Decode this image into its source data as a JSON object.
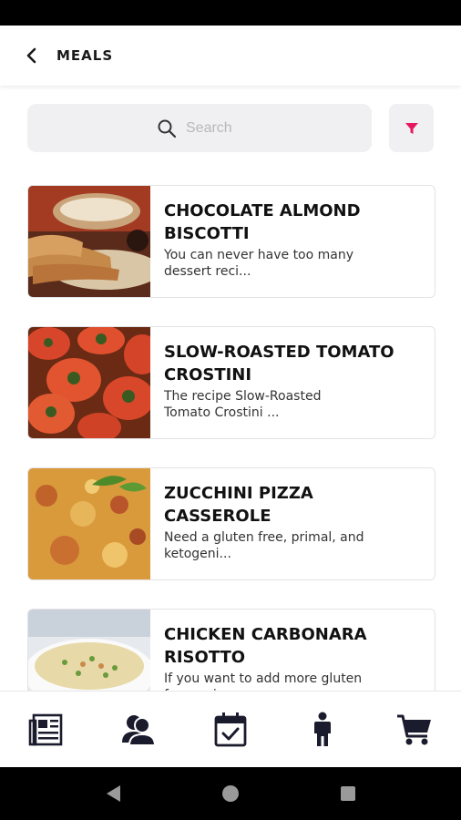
{
  "app": {
    "title": "MEALS"
  },
  "search": {
    "placeholder": "Search",
    "value": ""
  },
  "colors": {
    "accent": "#e6195e",
    "icon": "#1b1b2e"
  },
  "meals": [
    {
      "title": "CHOCOLATE ALMOND BISCOTTI",
      "description": "You can never have too many dessert reci..."
    },
    {
      "title": "SLOW-ROASTED TOMATO CROSTINI",
      "description": "The recipe Slow-Roasted Tomato Crostini ..."
    },
    {
      "title": "ZUCCHINI PIZZA CASSEROLE",
      "description": "Need a gluten free, primal, and ketogeni..."
    },
    {
      "title": "CHICKEN CARBONARA RISOTTO",
      "description": "If you want to add more gluten free reci..."
    }
  ],
  "bottom_nav": [
    {
      "icon": "newspaper-icon"
    },
    {
      "icon": "users-icon"
    },
    {
      "icon": "calendar-check-icon"
    },
    {
      "icon": "person-icon"
    },
    {
      "icon": "cart-icon"
    }
  ],
  "system_nav": [
    {
      "icon": "back-triangle-icon"
    },
    {
      "icon": "home-circle-icon"
    },
    {
      "icon": "recents-square-icon"
    }
  ]
}
